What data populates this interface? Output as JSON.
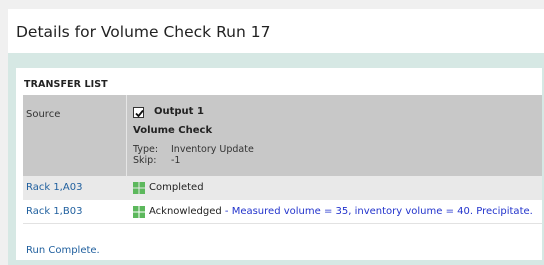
{
  "page": {
    "title": "Details for Volume Check Run 17"
  },
  "transfer_list": {
    "section_title": "TRANSFER LIST",
    "source": {
      "label": "Source",
      "checkbox_checked": true,
      "output_label": "Output 1",
      "volume_check": "Volume Check",
      "type_key": "Type:",
      "type_value": "Inventory Update",
      "skip_key": "Skip:",
      "skip_value": "-1"
    },
    "rows": [
      {
        "label": "Rack 1,A03",
        "status_icon": "grid-status-icon",
        "status": "Completed",
        "note": ""
      },
      {
        "label": "Rack 1,B03",
        "status_icon": "grid-status-icon",
        "status": "Acknowledged",
        "separator": " - ",
        "note": "Measured volume = 35, inventory volume = 40. Precipitate."
      }
    ],
    "footer": "Run Complete."
  },
  "colors": {
    "page_bg": "#f0f0f0",
    "frame_bg": "#d6e8e4",
    "source_row_bg": "#c8c8c8",
    "row_alt_bg": "#e9e9e9",
    "link": "#1f5f9e",
    "note": "#2233cc",
    "status_green": "#5cb85c"
  }
}
